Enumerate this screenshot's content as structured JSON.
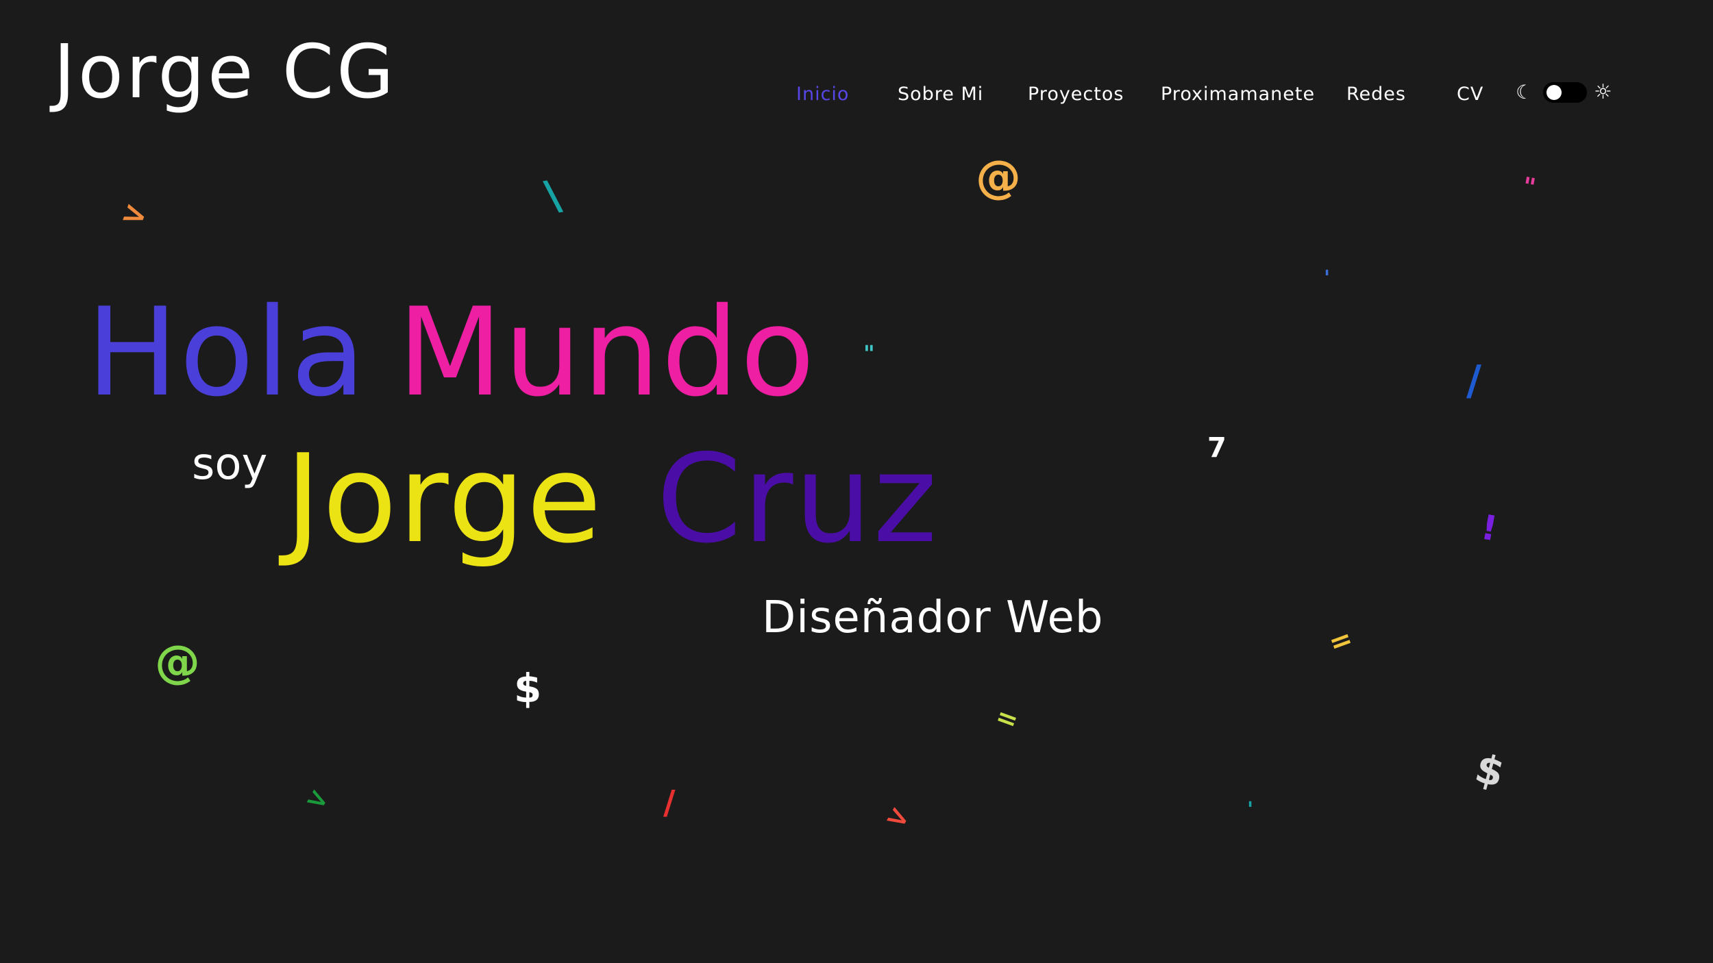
{
  "header": {
    "logo": "Jorge CG"
  },
  "nav": {
    "items": [
      {
        "label": "Inicio",
        "active": true
      },
      {
        "label": "Sobre Mi",
        "active": false
      },
      {
        "label": "Proyectos",
        "active": false
      },
      {
        "label": "Proximamanete",
        "active": false
      },
      {
        "label": "Redes",
        "active": false
      },
      {
        "label": "CV",
        "active": false
      }
    ],
    "active_color": "#5847e8"
  },
  "theme_toggle": {
    "moon_icon": "moon-icon",
    "sun_icon": "sun-icon",
    "moon_symbol": "☾",
    "sun_symbol": "☼"
  },
  "hero": {
    "greeting_1": "Hola",
    "greeting_2": "Mundo",
    "intro": "soy",
    "first_name": "Jorge",
    "last_name": "Cruz",
    "role": "Diseñador Web"
  },
  "colors": {
    "background": "#1b1b1c",
    "hola": "#4a3fd8",
    "mundo": "#ee1fa3",
    "jorge": "#ece315",
    "cruz": "#4a0ea6",
    "text": "#ffffff"
  },
  "decorations": [
    {
      "char": ">",
      "color": "#f08a3c"
    },
    {
      "char": "\\",
      "color": "#17a3a3"
    },
    {
      "char": "@",
      "color": "#f5b04a"
    },
    {
      "char": "\"",
      "color": "#e83c9c"
    },
    {
      "char": "'",
      "color": "#3a6fd8"
    },
    {
      "char": "\"",
      "color": "#3ec6c6"
    },
    {
      "char": "/",
      "color": "#1f5bd0"
    },
    {
      "char": "7",
      "color": "#ffffff"
    },
    {
      "char": "!",
      "color": "#7a1fe0"
    },
    {
      "char": "=",
      "color": "#f0c53c"
    },
    {
      "char": "@",
      "color": "#7fd64a"
    },
    {
      "char": "$",
      "color": "#ffffff"
    },
    {
      "char": "=",
      "color": "#c8e04a"
    },
    {
      "char": "$",
      "color": "#d9d9d9"
    },
    {
      "char": ">",
      "color": "#1a9a3a"
    },
    {
      "char": "/",
      "color": "#e83030"
    },
    {
      "char": ">",
      "color": "#f04a3c"
    },
    {
      "char": "'",
      "color": "#17a3a3"
    }
  ]
}
